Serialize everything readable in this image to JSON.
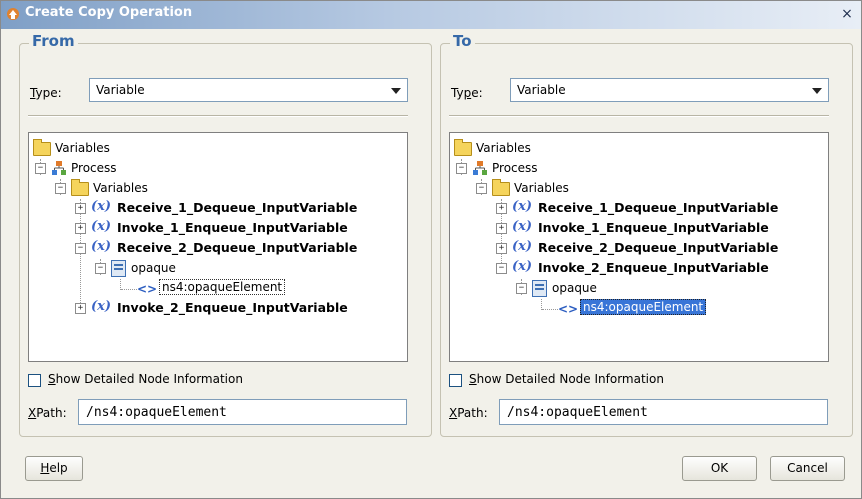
{
  "dialog": {
    "title": "Create Copy Operation",
    "close_glyph": "×",
    "accent_color": "#3669a8",
    "selection_color": "#3875d7"
  },
  "from": {
    "group_title": "From",
    "type_label": "Type:",
    "type_value": "Variable",
    "tree": {
      "root": "Variables",
      "process": "Process",
      "variables": "Variables",
      "var1": "Receive_1_Dequeue_InputVariable",
      "var2": "Invoke_1_Enqueue_InputVariable",
      "var3": "Receive_2_Dequeue_InputVariable",
      "part": "opaque",
      "element": "ns4:opaqueElement",
      "var4": "Invoke_2_Enqueue_InputVariable"
    },
    "show_detail_label": "Show Detailed Node Information",
    "xpath_label": "XPath:",
    "xpath_value": "/ns4:opaqueElement"
  },
  "to": {
    "group_title": "To",
    "type_label": "Type:",
    "type_value": "Variable",
    "tree": {
      "root": "Variables",
      "process": "Process",
      "variables": "Variables",
      "var1": "Receive_1_Dequeue_InputVariable",
      "var2": "Invoke_1_Enqueue_InputVariable",
      "var3": "Receive_2_Dequeue_InputVariable",
      "var4": "Invoke_2_Enqueue_InputVariable",
      "part": "opaque",
      "element": "ns4:opaqueElement"
    },
    "show_detail_label": "Show Detailed Node Information",
    "xpath_label": "XPath:",
    "xpath_value": "/ns4:opaqueElement"
  },
  "buttons": {
    "help": "Help",
    "ok": "OK",
    "cancel": "Cancel"
  },
  "icons": {
    "variable_icon_text": "(x)",
    "element_icon_text": "<>",
    "expand_glyph": "+",
    "collapse_glyph": "−"
  }
}
